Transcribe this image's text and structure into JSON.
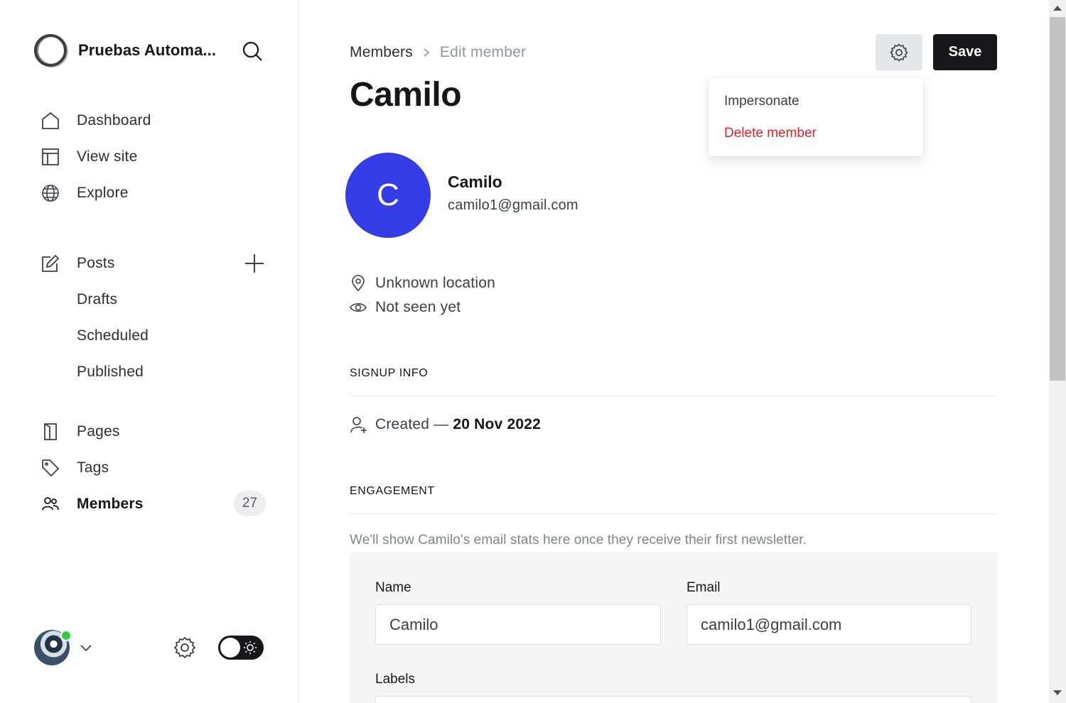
{
  "sidebar": {
    "site_name": "Pruebas Automa...",
    "nav": {
      "dashboard": "Dashboard",
      "view_site": "View site",
      "explore": "Explore",
      "posts": "Posts",
      "drafts": "Drafts",
      "scheduled": "Scheduled",
      "published": "Published",
      "pages": "Pages",
      "tags": "Tags",
      "members": "Members",
      "members_count": "27"
    },
    "icons": [
      "search-icon",
      "home-icon",
      "layout-icon",
      "globe-icon",
      "edit-icon",
      "plus-icon",
      "page-icon",
      "tag-icon",
      "members-icon",
      "chevron-down-icon",
      "gear-icon",
      "sun-icon"
    ],
    "online_status_color": "#30cf43"
  },
  "header": {
    "breadcrumb_parent": "Members",
    "breadcrumb_current": "Edit member",
    "title": "Camilo",
    "save_label": "Save"
  },
  "dropdown": {
    "impersonate": "Impersonate",
    "delete": "Delete member",
    "delete_color": "#e0212c"
  },
  "member": {
    "initial": "C",
    "name": "Camilo",
    "email": "camilo1@gmail.com",
    "avatar_color": "#343ce5",
    "location": "Unknown location",
    "last_seen": "Not seen yet"
  },
  "signup": {
    "heading": "SIGNUP INFO",
    "created_prefix": "Created —",
    "created_date": "20 Nov 2022"
  },
  "engagement": {
    "heading": "ENGAGEMENT",
    "note": "We'll show Camilo's email stats here once they receive their first newsletter."
  },
  "form": {
    "name_label": "Name",
    "name_value": "Camilo",
    "email_label": "Email",
    "email_value": "camilo1@gmail.com",
    "labels_label": "Labels"
  }
}
